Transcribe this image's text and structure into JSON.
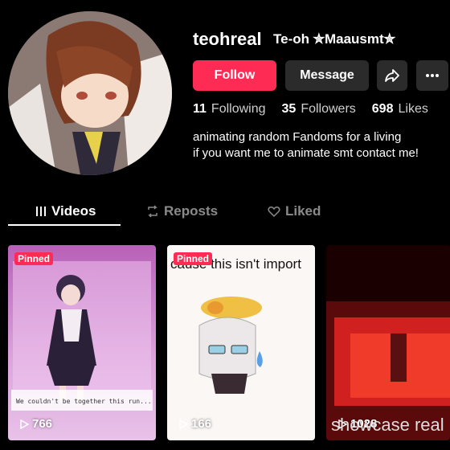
{
  "profile": {
    "username": "teohreal",
    "nickname": "Te-oh ✮Maausmt✮",
    "bio_line1": "animating random Fandoms for a living",
    "bio_line2": "if you want me to animate smt contact me!"
  },
  "buttons": {
    "follow": "Follow",
    "message": "Message",
    "share_icon": "share-arrow-icon",
    "more_icon": "more-dots-icon"
  },
  "stats": [
    {
      "count": "11",
      "label": "Following"
    },
    {
      "count": "35",
      "label": "Followers"
    },
    {
      "count": "698",
      "label": "Likes"
    }
  ],
  "tabs": [
    {
      "label": "Videos",
      "icon": "grid-bars-icon",
      "active": true
    },
    {
      "label": "Reposts",
      "icon": "repost-icon",
      "active": false
    },
    {
      "label": "Liked",
      "icon": "heart-outline-icon",
      "active": false
    }
  ],
  "videos": [
    {
      "pinned": "Pinned",
      "views": "766",
      "overlay_text": "We couldn't be together this run..."
    },
    {
      "pinned": "Pinned",
      "views": "166",
      "caption": "cause this isn't import"
    },
    {
      "views": "1028",
      "caption": "showcase real"
    }
  ],
  "colors": {
    "accent": "#fe2c55",
    "button_bg": "#2b2b2b",
    "background": "#000000"
  }
}
